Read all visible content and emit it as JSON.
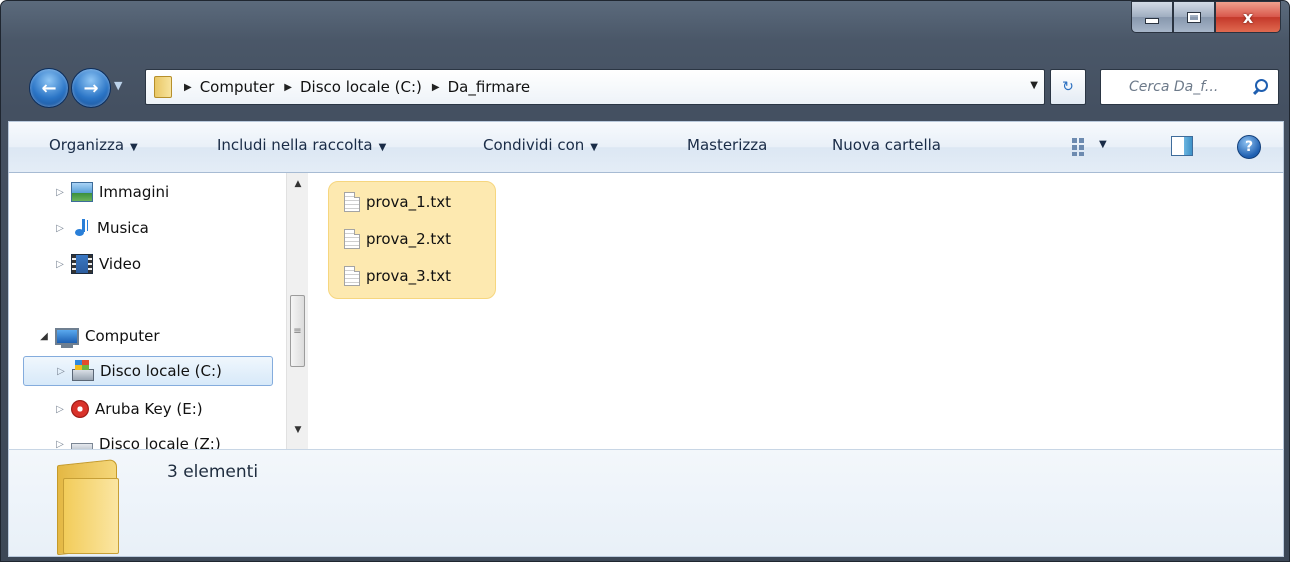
{
  "window": {
    "caption_buttons": {
      "minimize": "_",
      "maximize": "□",
      "close": "x"
    }
  },
  "navigation": {
    "back_icon": "back-arrow-icon",
    "forward_icon": "forward-arrow-icon",
    "breadcrumb": [
      "Computer",
      "Disco locale (C:)",
      "Da_firmare"
    ],
    "search_placeholder": "Cerca Da_f..."
  },
  "toolbar": {
    "organize": "Organizza",
    "include_library": "Includi nella raccolta",
    "share_with": "Condividi con",
    "burn": "Masterizza",
    "new_folder": "Nuova cartella"
  },
  "nav_tree": {
    "items": [
      {
        "label": "Immagini",
        "icon": "pictures-icon"
      },
      {
        "label": "Musica",
        "icon": "music-icon"
      },
      {
        "label": "Video",
        "icon": "video-icon"
      },
      {
        "label": "Computer",
        "icon": "computer-icon"
      },
      {
        "label": "Disco locale (C:)",
        "icon": "windows-drive-icon",
        "selected": true
      },
      {
        "label": "Aruba Key (E:)",
        "icon": "aruba-key-icon"
      },
      {
        "label": "Disco locale (Z:)",
        "icon": "drive-icon"
      }
    ]
  },
  "files": {
    "items": [
      {
        "name": "prova_1.txt",
        "icon": "text-file-icon"
      },
      {
        "name": "prova_2.txt",
        "icon": "text-file-icon"
      },
      {
        "name": "prova_3.txt",
        "icon": "text-file-icon"
      }
    ],
    "selection_color": "#fde9b0"
  },
  "details": {
    "item_count": "3 elementi"
  }
}
